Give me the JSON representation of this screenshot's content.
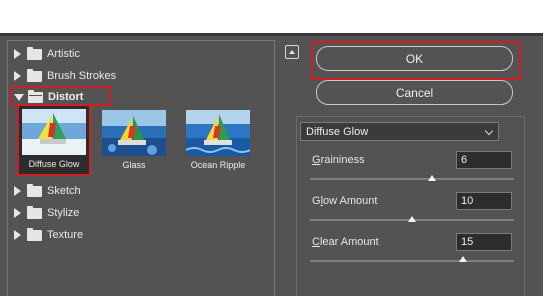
{
  "categories": [
    {
      "label": "Artistic",
      "expanded": false
    },
    {
      "label": "Brush Strokes",
      "expanded": false
    },
    {
      "label": "Distort",
      "expanded": true
    },
    {
      "label": "Sketch",
      "expanded": false
    },
    {
      "label": "Stylize",
      "expanded": false
    },
    {
      "label": "Texture",
      "expanded": false
    }
  ],
  "thumbnails": [
    {
      "label": "Diffuse Glow",
      "selected": true
    },
    {
      "label": "Glass",
      "selected": false
    },
    {
      "label": "Ocean Ripple",
      "selected": false
    }
  ],
  "buttons": {
    "ok": "OK",
    "cancel": "Cancel"
  },
  "filter_select": {
    "value": "Diffuse Glow"
  },
  "params": [
    {
      "label": "Graininess",
      "mnemonic": "G",
      "rest": "raininess",
      "value": "6",
      "level": 0.6
    },
    {
      "label": "Glow Amount",
      "mnemonic": "l",
      "pre": "G",
      "rest": "ow Amount",
      "value": "10",
      "level": 0.5
    },
    {
      "label": "Clear Amount",
      "mnemonic": "C",
      "rest": "lear Amount",
      "value": "15",
      "level": 0.75
    }
  ],
  "colors": {
    "accent_red": "#cf1f25",
    "panel_bg": "#535353"
  }
}
